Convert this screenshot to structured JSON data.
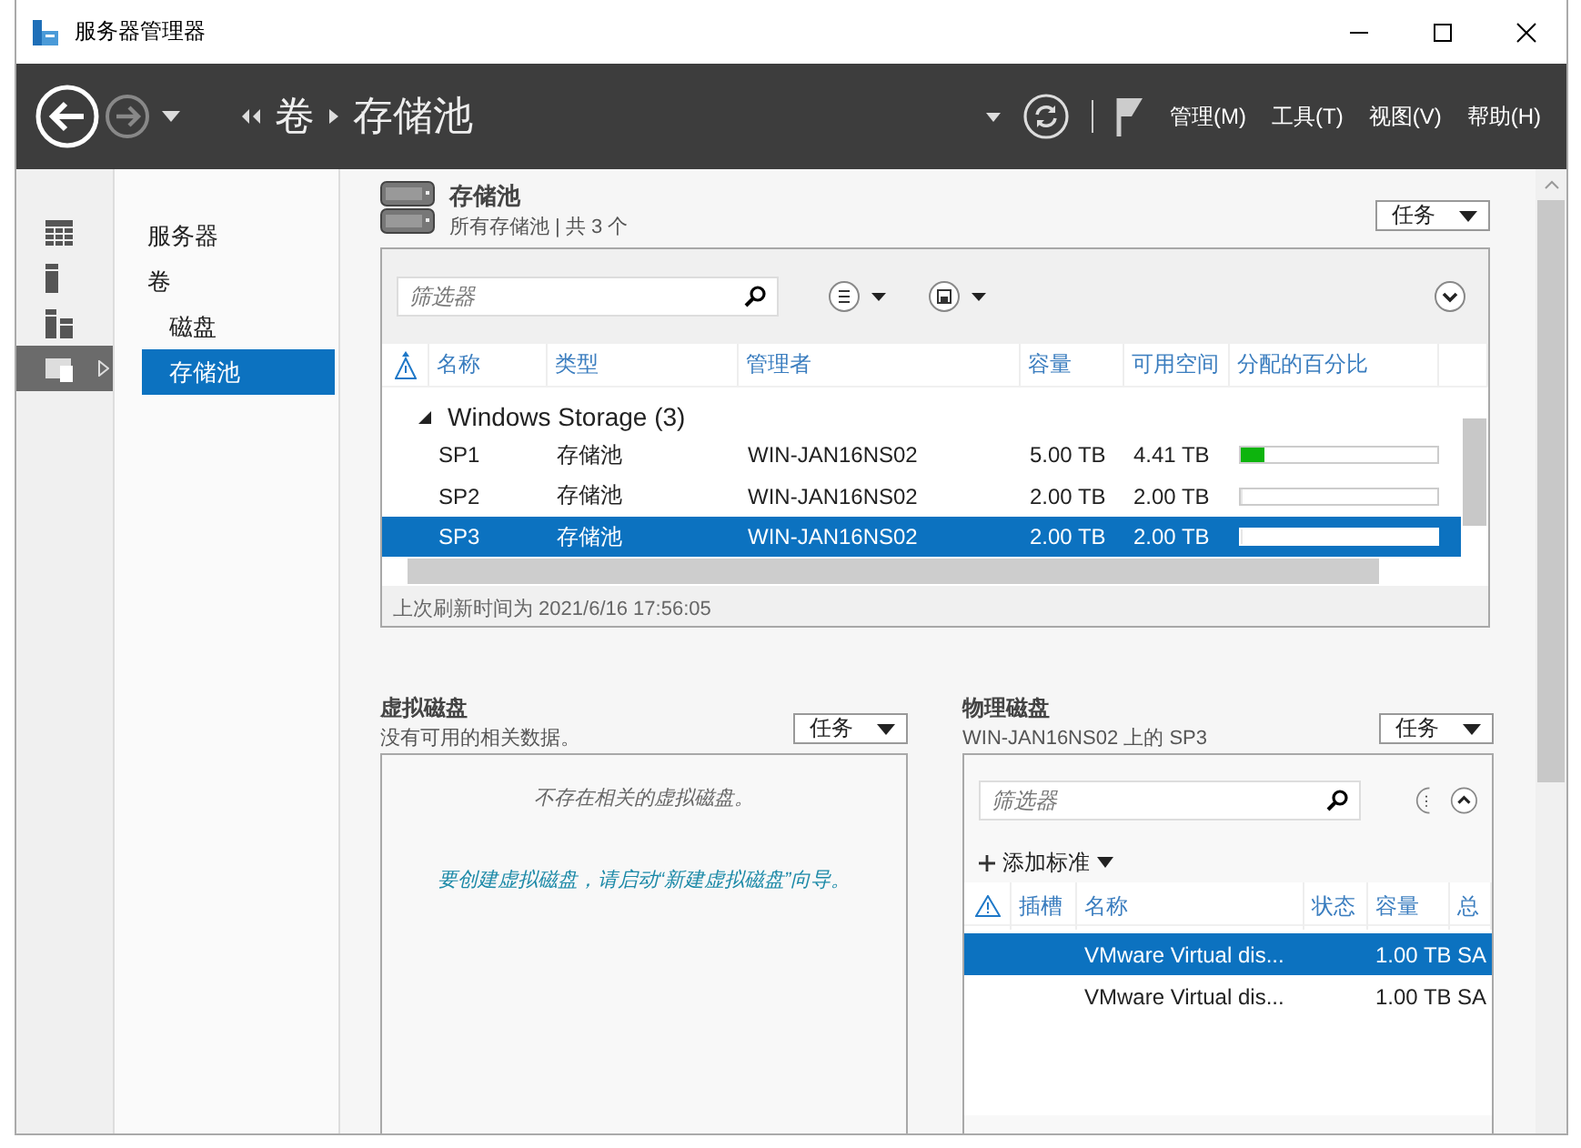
{
  "window": {
    "title": "服务器管理器"
  },
  "breadcrumb": [
    "卷",
    "存储池"
  ],
  "menus": [
    "管理(M)",
    "工具(T)",
    "视图(V)",
    "帮助(H)"
  ],
  "rail": [
    {
      "kind": "dashboard",
      "selected": false
    },
    {
      "kind": "server",
      "selected": false
    },
    {
      "kind": "servers",
      "selected": false
    },
    {
      "kind": "storage",
      "selected": true
    }
  ],
  "nav": [
    {
      "label": "服务器",
      "selected": false
    },
    {
      "label": "卷",
      "selected": false,
      "children": [
        {
          "label": "磁盘",
          "selected": false
        },
        {
          "label": "存储池",
          "selected": true
        }
      ]
    }
  ],
  "pools": {
    "title": "存储池",
    "subtitle": "所有存储池 | 共 3 个",
    "tasks": "任务",
    "filter": {
      "placeholder": "筛选器"
    },
    "columns": [
      "名称",
      "类型",
      "管理者",
      "容量",
      "可用空间",
      "分配的百分比"
    ],
    "group": {
      "label": "Windows Storage (3)",
      "expanded": true
    },
    "rows": [
      {
        "name": "SP1",
        "type": "存储池",
        "manager": "WIN-JAN16NS02",
        "capacity": "5.00 TB",
        "free": "4.41 TB",
        "level": 0.12,
        "selected": false
      },
      {
        "name": "SP2",
        "type": "存储池",
        "manager": "WIN-JAN16NS02",
        "capacity": "2.00 TB",
        "free": "2.00 TB",
        "level": 0,
        "selected": false
      },
      {
        "name": "SP3",
        "type": "存储池",
        "manager": "WIN-JAN16NS02",
        "capacity": "2.00 TB",
        "free": "2.00 TB",
        "level": 0,
        "selected": true
      }
    ],
    "refreshed": "上次刷新时间为 2021/6/16 17:56:05"
  },
  "virtual_disks": {
    "title": "虚拟磁盘",
    "subtitle": "没有可用的相关数据。",
    "tasks": "任务",
    "empty": "不存在相关的虚拟磁盘。",
    "hint": "要创建虚拟磁盘，请启动“新建虚拟磁盘”向导。"
  },
  "physical_disks": {
    "title": "物理磁盘",
    "subtitle": "WIN-JAN16NS02 上的 SP3",
    "tasks": "任务",
    "filter": {
      "placeholder": "筛选器"
    },
    "add_criteria": "添加标准",
    "columns": [
      "插槽",
      "名称",
      "状态",
      "容量",
      "总"
    ],
    "rows": [
      {
        "name": "VMware Virtual dis...",
        "capacity": "1.00 TB",
        "column_5": "SA",
        "selected": true
      },
      {
        "name": "VMware Virtual dis...",
        "capacity": "1.00 TB",
        "column_5": "SA",
        "selected": false
      }
    ]
  }
}
